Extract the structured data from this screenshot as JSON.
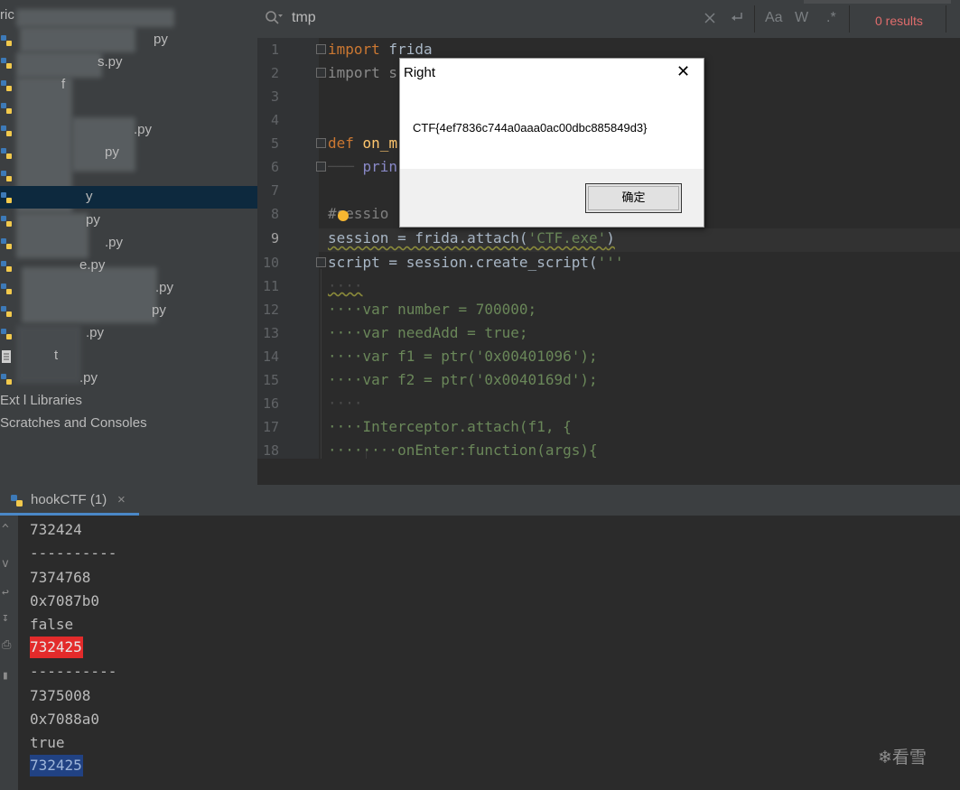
{
  "project_tree": {
    "items": [
      {
        "label": "ric",
        "icon": "folder-icon"
      },
      {
        "label": "py",
        "icon": "python-file-icon"
      },
      {
        "label": "s.py",
        "icon": "python-file-icon"
      },
      {
        "label": "f",
        "icon": "python-file-icon"
      },
      {
        "label": "",
        "icon": "python-file-icon"
      },
      {
        "label": ".py",
        "icon": "python-file-icon"
      },
      {
        "label": "py",
        "icon": "python-file-icon"
      },
      {
        "label": "",
        "icon": "python-file-icon"
      },
      {
        "label": "y",
        "icon": "python-file-icon"
      },
      {
        "label": "py",
        "icon": "python-file-icon"
      },
      {
        "label": ".py",
        "icon": "python-file-icon"
      },
      {
        "label": "e.py",
        "icon": "python-file-icon"
      },
      {
        "label": ".py",
        "icon": "python-file-icon"
      },
      {
        "label": "py",
        "icon": "python-file-icon"
      },
      {
        "label": ".py",
        "icon": "python-file-icon"
      },
      {
        "label": "t",
        "icon": "text-file-icon"
      },
      {
        "label": ".py",
        "icon": "python-file-icon"
      }
    ],
    "external_libraries": "Ext l Libraries",
    "scratches": "Scratches and Consoles"
  },
  "search": {
    "query": "tmp",
    "results": "0 results",
    "match_case": "Aa",
    "whole_words": "W",
    "regex": ".*"
  },
  "editor": {
    "line_numbers": [
      "1",
      "2",
      "3",
      "4",
      "5",
      "6",
      "7",
      "8",
      "9",
      "10",
      "11",
      "12",
      "13",
      "14",
      "15",
      "16",
      "17",
      "18"
    ],
    "current_line": "9",
    "lines": {
      "l1_kw": "import",
      "l1_rest": " frida",
      "l2_kw": "import",
      "l2_rest": " s",
      "l5_kw": "def",
      "l5_fn": " on_m",
      "l6_ws": "─── ",
      "l6_rest": "prin",
      "l8_cm": "#sessio",
      "l9_a": "session = frida.attach(",
      "l9_str": "'CTF.exe'",
      "l9_b": ")",
      "l10_a": "script = session.create_script(",
      "l10_str": "'''",
      "l11": "····",
      "l12": "····var number = 700000;",
      "l13": "····var needAdd = true;",
      "l14": "····var f1 = ptr('0x00401096');",
      "l15": "····var f2 = ptr('0x0040169d');",
      "l16": "····",
      "l17": "····Interceptor.attach(f1, {",
      "l18": "········onEnter:function(args){"
    }
  },
  "run": {
    "tab_label": "hookCTF (1)",
    "close": "×",
    "output": [
      "732424",
      "----------",
      "7374768",
      "0x7087b0",
      "false",
      "732425",
      "----------",
      "7375008",
      "0x7088a0",
      "true",
      "732425"
    ],
    "watermark": "❄看雪"
  },
  "dialog": {
    "title": "Right",
    "close": "✕",
    "message": "CTF{4ef7836c744a0aaa0ac00dbc885849d3}",
    "ok_label": "确定"
  },
  "colors": {
    "keyword": "#cc7832",
    "string": "#6a8759",
    "function": "#ffc66d",
    "highlight_red": "#e32b2b",
    "highlight_blue": "#214283",
    "results_red": "#e06c6c"
  }
}
